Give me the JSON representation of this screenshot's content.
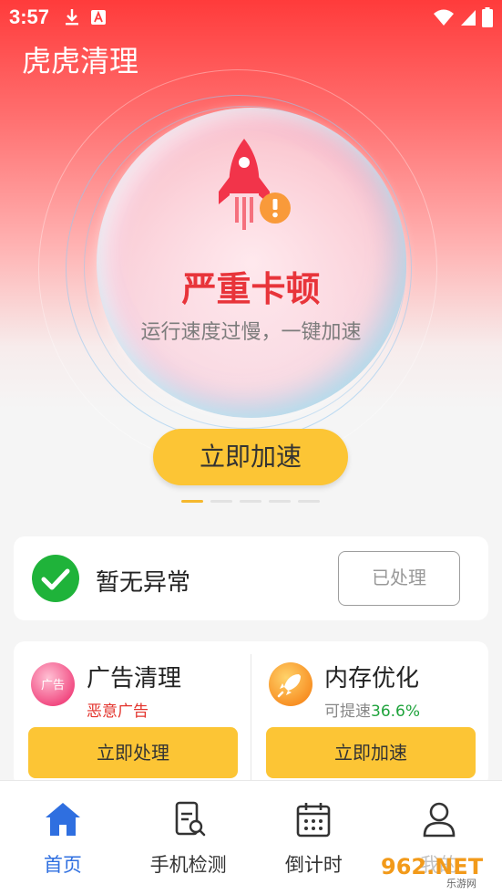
{
  "status_bar": {
    "time": "3:57"
  },
  "app": {
    "title": "虎虎清理"
  },
  "hero": {
    "heading": "严重卡顿",
    "subtitle": "运行速度过慢，一键加速",
    "action_label": "立即加速",
    "page_indicator": {
      "count": 5,
      "active": 0
    }
  },
  "status_card": {
    "text": "暂无异常",
    "button_label": "已处理"
  },
  "tools": [
    {
      "icon_text": "广告",
      "title": "广告清理",
      "subtitle": "恶意广告",
      "button_label": "立即处理"
    },
    {
      "title": "内存优化",
      "subtitle_prefix": "可提速",
      "subtitle_value": "36.6%",
      "button_label": "立即加速"
    }
  ],
  "nav": [
    {
      "label": "首页",
      "icon": "home-icon",
      "active": true
    },
    {
      "label": "手机检测",
      "icon": "phone-scan-icon",
      "active": false
    },
    {
      "label": "倒计时",
      "icon": "calendar-icon",
      "active": false
    },
    {
      "label": "我的",
      "icon": "user-icon",
      "active": false
    }
  ],
  "watermark": {
    "text": "962.NET",
    "sub": "乐游网"
  },
  "colors": {
    "accent": "#fcc535",
    "danger": "#e8343a",
    "nav_active": "#2f6fe0",
    "success": "#1fa33c"
  }
}
